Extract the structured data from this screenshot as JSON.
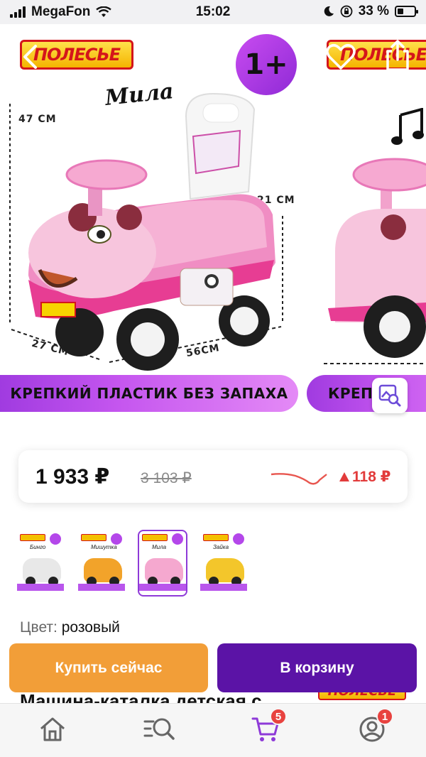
{
  "status_bar": {
    "carrier": "MegaFon",
    "time": "15:02",
    "battery": "33 %"
  },
  "hero": {
    "brand": "ПОЛЕСЬЕ",
    "age_badge": "1+",
    "model_name": "Мила",
    "dimensions": {
      "height": "47 CM",
      "seat_height": "21 CM",
      "width": "27 CM",
      "length": "56CM"
    },
    "banner_text": "КРЕПКИЙ ПЛАСТИК БЕЗ ЗАПАХА",
    "banner_text_2": "КРЕП",
    "icons": {
      "back": "chevron-left-icon",
      "favorite": "heart-icon",
      "share": "share-icon",
      "image_search": "image-search-icon"
    }
  },
  "price": {
    "current": "1 933 ₽",
    "old": "3 103 ₽",
    "delta": "118 ₽",
    "delta_color": "#e23b3b"
  },
  "variants": [
    {
      "name": "Бинго",
      "body_color": "#e8e8e8",
      "accent": "#222222",
      "selected": false
    },
    {
      "name": "Мишутка",
      "body_color": "#f2a32a",
      "accent": "#2b56c7",
      "selected": false
    },
    {
      "name": "Мила",
      "body_color": "#f5a8cf",
      "accent": "#e23c8f",
      "selected": true
    },
    {
      "name": "Зайка",
      "body_color": "#f3c62b",
      "accent": "#e38e1b",
      "selected": false
    }
  ],
  "color": {
    "label": "Цвет:",
    "value": "розовый"
  },
  "actions": {
    "buy_now": "Купить сейчас",
    "add_to_cart": "В корзину",
    "buy_color": "#f29e38",
    "cart_color": "#5b13a6"
  },
  "product_title": "Машина-каталка детская с",
  "bottom_nav": {
    "home": "home-icon",
    "catalog": "catalog-search-icon",
    "cart": "cart-icon",
    "cart_badge": "5",
    "profile": "profile-icon",
    "profile_badge": "1",
    "accent": "#8e3ad8"
  }
}
